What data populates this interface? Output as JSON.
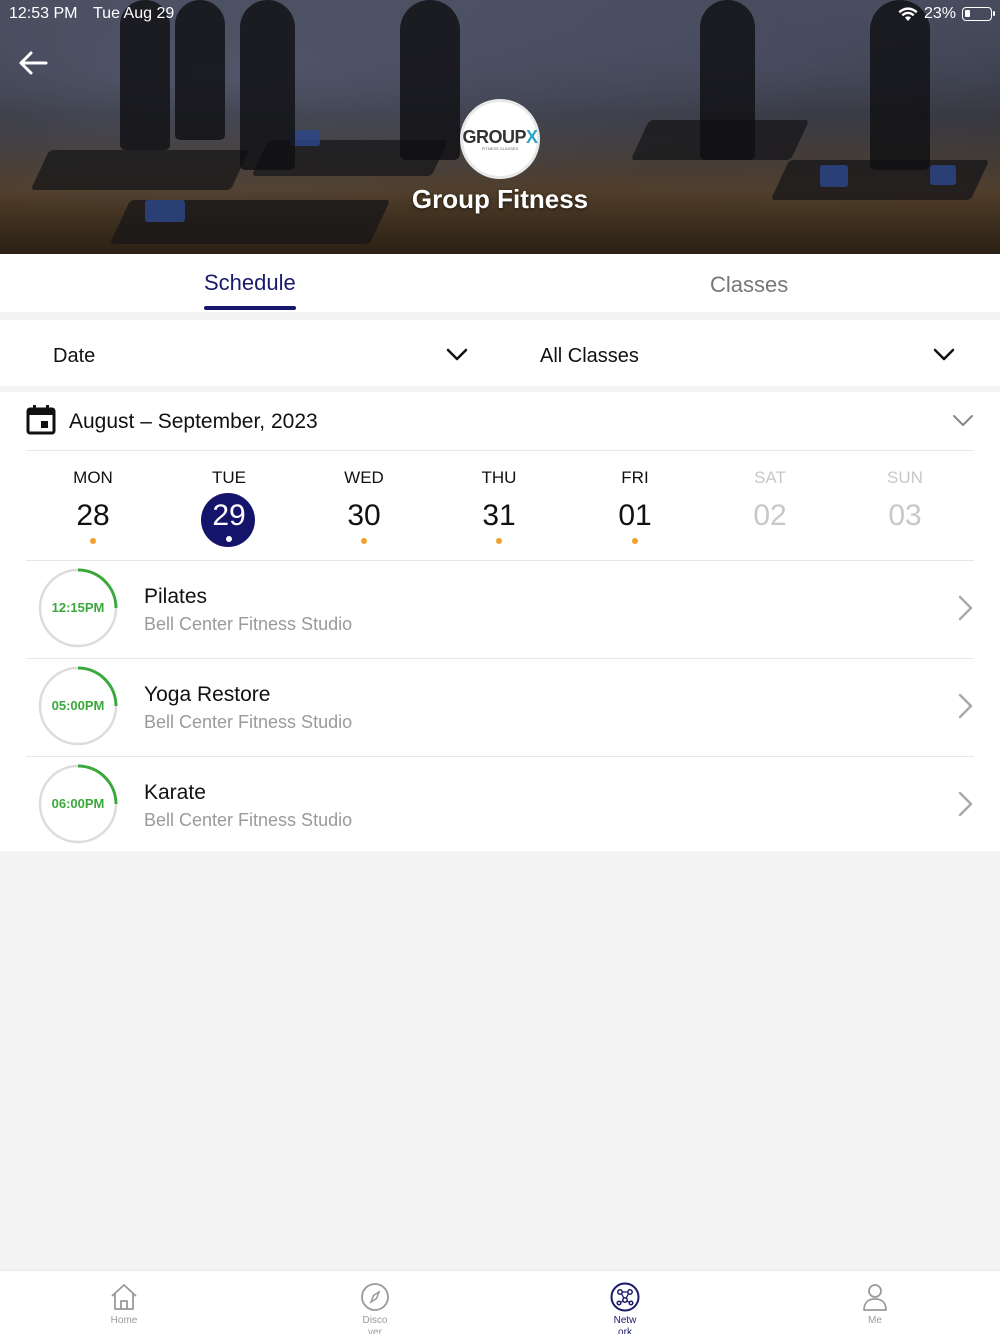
{
  "status_bar": {
    "time": "12:53 PM",
    "date": "Tue Aug 29",
    "battery": "23%"
  },
  "header": {
    "title": "Group Fitness",
    "logo_text": "GROUP",
    "logo_accent": "X",
    "logo_subtext": "FITNESS CLASSES"
  },
  "tabs": [
    {
      "label": "Schedule",
      "active": true
    },
    {
      "label": "Classes",
      "active": false
    }
  ],
  "filters": {
    "date_label": "Date",
    "class_label": "All Classes"
  },
  "calendar": {
    "month_label": "August – September,  2023",
    "days": [
      {
        "name": "MON",
        "num": "28",
        "has_events": true,
        "selected": false,
        "disabled": false
      },
      {
        "name": "TUE",
        "num": "29",
        "has_events": true,
        "selected": true,
        "disabled": false
      },
      {
        "name": "WED",
        "num": "30",
        "has_events": true,
        "selected": false,
        "disabled": false
      },
      {
        "name": "THU",
        "num": "31",
        "has_events": true,
        "selected": false,
        "disabled": false
      },
      {
        "name": "FRI",
        "num": "01",
        "has_events": true,
        "selected": false,
        "disabled": false
      },
      {
        "name": "SAT",
        "num": "02",
        "has_events": false,
        "selected": false,
        "disabled": true
      },
      {
        "name": "SUN",
        "num": "03",
        "has_events": false,
        "selected": false,
        "disabled": true
      }
    ]
  },
  "classes": [
    {
      "time": "12:15PM",
      "name": "Pilates",
      "location": "Bell Center Fitness Studio",
      "progress": 0.25
    },
    {
      "time": "05:00PM",
      "name": "Yoga Restore",
      "location": "Bell Center Fitness Studio",
      "progress": 0.25
    },
    {
      "time": "06:00PM",
      "name": "Karate",
      "location": "Bell Center Fitness Studio",
      "progress": 0.25
    }
  ],
  "bottom_nav": [
    {
      "label": "Home",
      "icon": "home-icon",
      "active": false
    },
    {
      "label": "Disco ver",
      "icon": "compass-icon",
      "active": false
    },
    {
      "label": "Netw ork",
      "icon": "network-icon",
      "active": true
    },
    {
      "label": "Me",
      "icon": "person-icon",
      "active": false
    }
  ],
  "colors": {
    "primary": "#15146b",
    "event_dot": "#f0a030",
    "time_green": "#3aa83a",
    "muted": "#9a9a9a"
  }
}
